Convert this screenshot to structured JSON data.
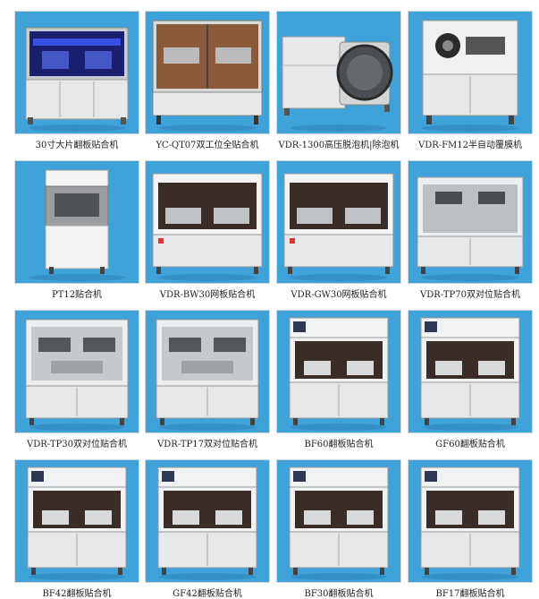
{
  "products": [
    {
      "label": "30寸大片翻板贴合机",
      "style": "lit",
      "icon": "machine-lit-icon"
    },
    {
      "label": "YC-QT07双工位全贴合机",
      "style": "frame",
      "icon": "machine-frame-icon"
    },
    {
      "label": "VDR-1300高压脱泡机|除泡机",
      "style": "autoclave",
      "icon": "autoclave-icon"
    },
    {
      "label": "VDR-FM12半自动覆膜机",
      "style": "film",
      "icon": "film-machine-icon"
    },
    {
      "label": "PT12贴合机",
      "style": "pt12",
      "icon": "pt12-machine-icon"
    },
    {
      "label": "VDR-BW30网板贴合机",
      "style": "mesh",
      "icon": "mesh-machine-icon"
    },
    {
      "label": "VDR-GW30网板贴合机",
      "style": "mesh",
      "icon": "mesh-machine-icon"
    },
    {
      "label": "VDR-TP70双对位贴合机",
      "style": "tp70",
      "icon": "dual-align-machine-icon"
    },
    {
      "label": "VDR-TP30双对位贴合机",
      "style": "tp",
      "icon": "dual-align-machine-icon"
    },
    {
      "label": "VDR-TP17双对位贴合机",
      "style": "tp",
      "icon": "dual-align-machine-icon"
    },
    {
      "label": "BF60翻板贴合机",
      "style": "flip",
      "icon": "flip-machine-icon"
    },
    {
      "label": "GF60翻板贴合机",
      "style": "flip",
      "icon": "flip-machine-icon"
    },
    {
      "label": "BF42翻板贴合机",
      "style": "flip",
      "icon": "flip-machine-icon"
    },
    {
      "label": "GF42翻板贴合机",
      "style": "flip",
      "icon": "flip-machine-icon"
    },
    {
      "label": "BF30翻板贴合机",
      "style": "flip",
      "icon": "flip-machine-icon"
    },
    {
      "label": "BF17翻板贴合机",
      "style": "flip",
      "icon": "flip-machine-icon"
    }
  ],
  "colors": {
    "photo_background": "#3fa2d9",
    "machine_body": "#e6e8ea",
    "machine_dark": "#3a2c26"
  }
}
